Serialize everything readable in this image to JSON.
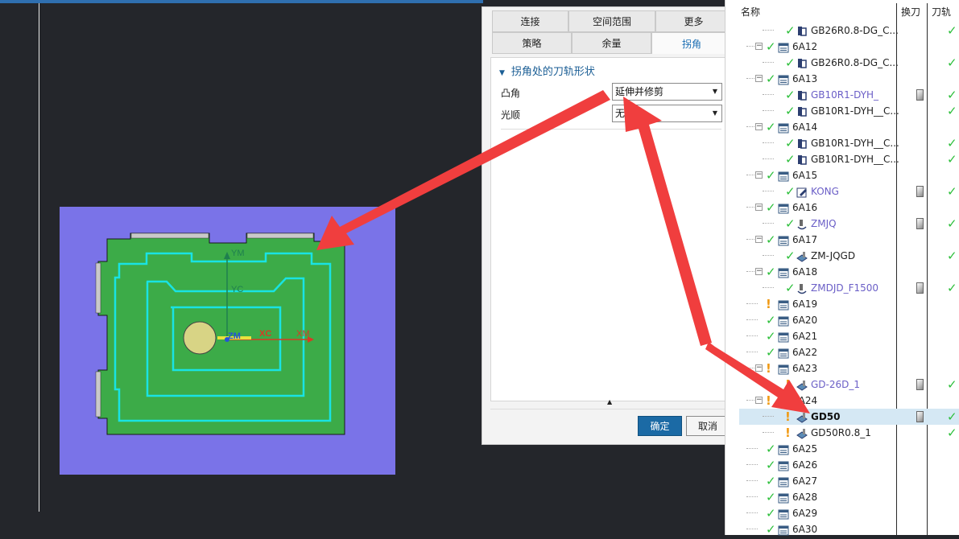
{
  "graphics": {
    "axis_labels": [
      "YM",
      "YC",
      "ZM",
      "XC",
      "XM"
    ],
    "colors": {
      "background": "#24262b",
      "stock": "#7a73e8",
      "part": "#3cab48",
      "toolpath": "#19e3e3",
      "tool_circle": "#d8d485"
    }
  },
  "dialog": {
    "tabs_row1": [
      "连接",
      "空间范围",
      "更多"
    ],
    "tabs_row2": [
      "策略",
      "余量",
      "拐角"
    ],
    "active_tab": "拐角",
    "section_title": "拐角处的刀轨形状",
    "fields": [
      {
        "label": "凸角",
        "value": "延伸并修剪"
      },
      {
        "label": "光顺",
        "value": "无"
      }
    ],
    "ok_label": "确定",
    "cancel_label": "取消"
  },
  "navigator": {
    "col_name": "名称",
    "col_tool_change": "换刀",
    "col_path": "刀轨",
    "rows": [
      {
        "level": 2,
        "status": "ok",
        "icon": "operation-icon",
        "label": "GB26R0.8-DG_C...",
        "style": "dark",
        "tool": false,
        "path": true
      },
      {
        "level": 1,
        "status": "ok",
        "icon": "program-group-icon",
        "label": "6A12",
        "style": "dark",
        "tool": false,
        "path": false,
        "toggle": "−"
      },
      {
        "level": 2,
        "status": "ok",
        "icon": "operation-icon",
        "label": "GB26R0.8-DG_C...",
        "style": "dark",
        "tool": false,
        "path": true
      },
      {
        "level": 1,
        "status": "ok",
        "icon": "program-group-icon",
        "label": "6A13",
        "style": "dark",
        "tool": false,
        "path": false,
        "toggle": "−"
      },
      {
        "level": 2,
        "status": "ok",
        "icon": "operation-icon",
        "label": "GB10R1-DYH_",
        "style": "blue",
        "tool": true,
        "path": true
      },
      {
        "level": 2,
        "status": "ok",
        "icon": "operation-icon",
        "label": "GB10R1-DYH__C...",
        "style": "dark",
        "tool": false,
        "path": true
      },
      {
        "level": 1,
        "status": "ok",
        "icon": "program-group-icon",
        "label": "6A14",
        "style": "dark",
        "tool": false,
        "path": false,
        "toggle": "−"
      },
      {
        "level": 2,
        "status": "ok",
        "icon": "operation-icon",
        "label": "GB10R1-DYH__C...",
        "style": "dark",
        "tool": false,
        "path": true
      },
      {
        "level": 2,
        "status": "ok",
        "icon": "operation-icon",
        "label": "GB10R1-DYH__C...",
        "style": "dark",
        "tool": false,
        "path": true
      },
      {
        "level": 1,
        "status": "ok",
        "icon": "program-group-icon",
        "label": "6A15",
        "style": "dark",
        "tool": false,
        "path": false,
        "toggle": "−"
      },
      {
        "level": 2,
        "status": "ok",
        "icon": "edit-icon",
        "label": "KONG",
        "style": "blue",
        "tool": true,
        "path": true
      },
      {
        "level": 1,
        "status": "ok",
        "icon": "program-group-icon",
        "label": "6A16",
        "style": "dark",
        "tool": false,
        "path": false,
        "toggle": "−"
      },
      {
        "level": 2,
        "status": "ok",
        "icon": "drill-icon",
        "label": "ZMJQ",
        "style": "blue",
        "tool": true,
        "path": true
      },
      {
        "level": 1,
        "status": "ok",
        "icon": "program-group-icon",
        "label": "6A17",
        "style": "dark",
        "tool": false,
        "path": false,
        "toggle": "−"
      },
      {
        "level": 2,
        "status": "ok",
        "icon": "mill-icon",
        "label": "ZM-JQGD",
        "style": "dark",
        "tool": false,
        "path": true
      },
      {
        "level": 1,
        "status": "ok",
        "icon": "program-group-icon",
        "label": "6A18",
        "style": "dark",
        "tool": false,
        "path": false,
        "toggle": "−"
      },
      {
        "level": 2,
        "status": "ok",
        "icon": "drill-icon",
        "label": "ZMDJD_F1500",
        "style": "blue",
        "tool": true,
        "path": true
      },
      {
        "level": 1,
        "status": "warn",
        "icon": "program-group-icon",
        "label": "6A19",
        "style": "dark",
        "tool": false,
        "path": false
      },
      {
        "level": 1,
        "status": "ok",
        "icon": "program-group-icon",
        "label": "6A20",
        "style": "dark",
        "tool": false,
        "path": false
      },
      {
        "level": 1,
        "status": "ok",
        "icon": "program-group-icon",
        "label": "6A21",
        "style": "dark",
        "tool": false,
        "path": false
      },
      {
        "level": 1,
        "status": "ok",
        "icon": "program-group-icon",
        "label": "6A22",
        "style": "dark",
        "tool": false,
        "path": false
      },
      {
        "level": 1,
        "status": "warn",
        "icon": "program-group-icon",
        "label": "6A23",
        "style": "dark",
        "tool": false,
        "path": false,
        "toggle": "−"
      },
      {
        "level": 2,
        "status": "warn",
        "icon": "mill-icon",
        "label": "GD-26D_1",
        "style": "blue",
        "tool": true,
        "path": true
      },
      {
        "level": 1,
        "status": "warn",
        "icon": "program-group-icon",
        "label": "6A24",
        "style": "dark",
        "tool": false,
        "path": false,
        "toggle": "−"
      },
      {
        "level": 2,
        "status": "warn",
        "icon": "mill-icon",
        "label": "GD50",
        "style": "bold",
        "tool": true,
        "path": true,
        "selected": true
      },
      {
        "level": 2,
        "status": "warn",
        "icon": "mill-icon",
        "label": "GD50R0.8_1",
        "style": "dark",
        "tool": false,
        "path": true
      },
      {
        "level": 1,
        "status": "ok",
        "icon": "program-group-icon",
        "label": "6A25",
        "style": "dark",
        "tool": false,
        "path": false
      },
      {
        "level": 1,
        "status": "ok",
        "icon": "program-group-icon",
        "label": "6A26",
        "style": "dark",
        "tool": false,
        "path": false
      },
      {
        "level": 1,
        "status": "ok",
        "icon": "program-group-icon",
        "label": "6A27",
        "style": "dark",
        "tool": false,
        "path": false
      },
      {
        "level": 1,
        "status": "ok",
        "icon": "program-group-icon",
        "label": "6A28",
        "style": "dark",
        "tool": false,
        "path": false
      },
      {
        "level": 1,
        "status": "ok",
        "icon": "program-group-icon",
        "label": "6A29",
        "style": "dark",
        "tool": false,
        "path": false
      },
      {
        "level": 1,
        "status": "ok",
        "icon": "program-group-icon",
        "label": "6A30",
        "style": "dark",
        "tool": false,
        "path": false
      }
    ]
  }
}
